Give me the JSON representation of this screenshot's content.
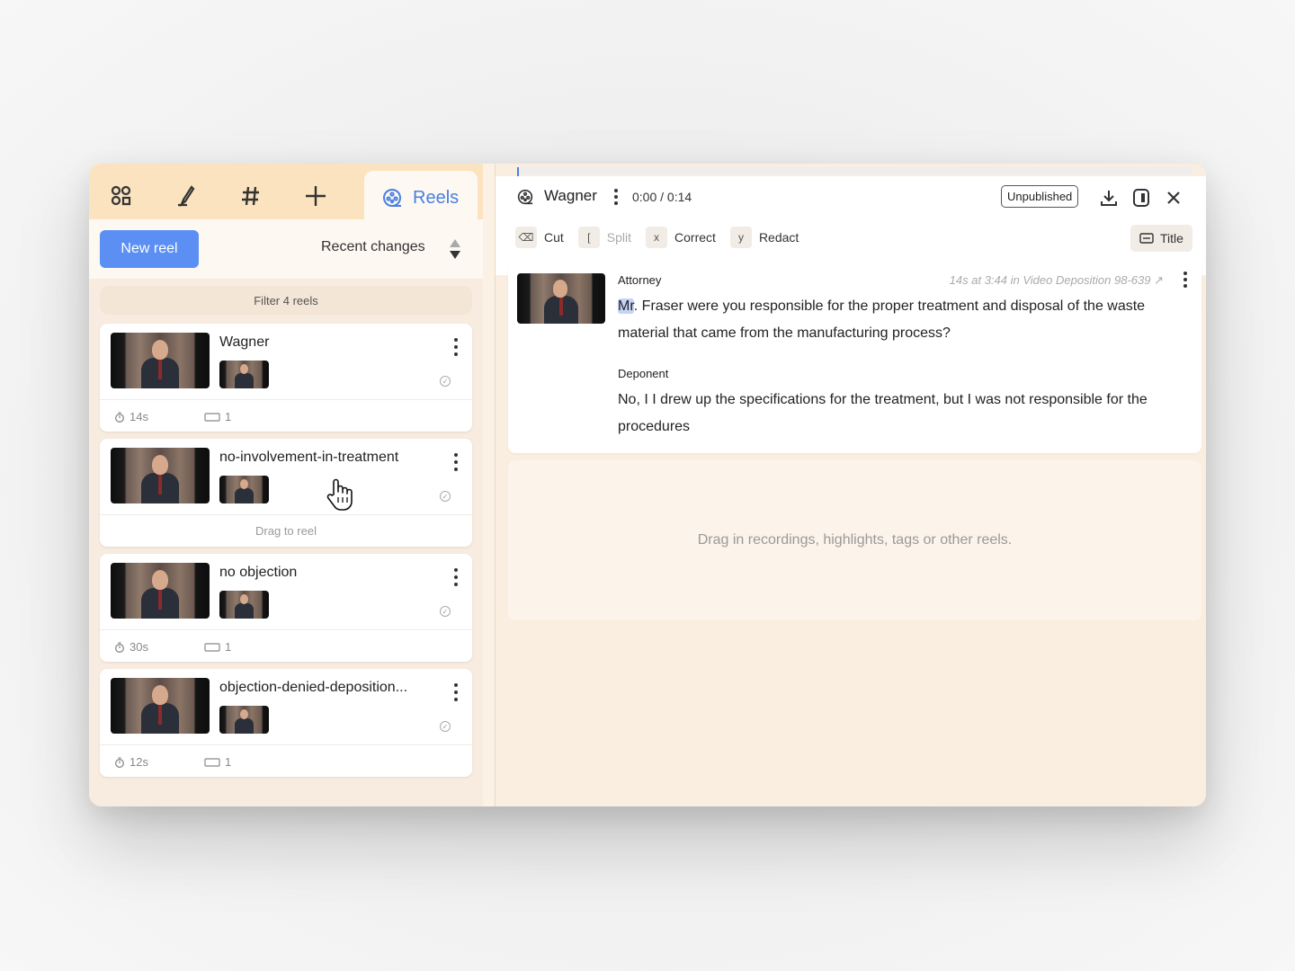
{
  "tabs": {
    "icons": [
      "people-icon",
      "marker-icon",
      "hashtag-icon",
      "plus-icon"
    ],
    "reels_label": "Reels"
  },
  "toolbar": {
    "new_reel_label": "New reel",
    "sort_label": "Recent changes"
  },
  "filter": {
    "label": "Filter 4 reels"
  },
  "reels": [
    {
      "title": "Wagner",
      "duration": "14s",
      "clip_count": "1"
    },
    {
      "title": "no-involvement-in-treatment",
      "drag_hint": "Drag to reel"
    },
    {
      "title": "no objection",
      "duration": "30s",
      "clip_count": "1"
    },
    {
      "title": "objection-denied-deposition...",
      "duration": "12s",
      "clip_count": "1"
    }
  ],
  "editor": {
    "title": "Wagner",
    "time": "0:00 / 0:14",
    "status": "Unpublished",
    "actions": [
      {
        "key": "⌫",
        "label": "Cut"
      },
      {
        "key": "[",
        "label": "Split"
      },
      {
        "key": "x",
        "label": "Correct"
      },
      {
        "key": "y",
        "label": "Redact"
      }
    ],
    "title_button": "Title",
    "clip": {
      "source": "14s at 3:44 in Video Deposition 98-639 ↗",
      "speaker1": "Attorney",
      "word_highlight": "Mr",
      "text1_rest": ". Fraser were you responsible for the proper treatment and disposal of the waste material that came from the manufacturing process?",
      "speaker2": "Deponent",
      "text2": "No, I I drew up the specifications for the treatment, but I was not responsible for the procedures"
    },
    "dropzone": "Drag in recordings, highlights, tags or other reels."
  }
}
